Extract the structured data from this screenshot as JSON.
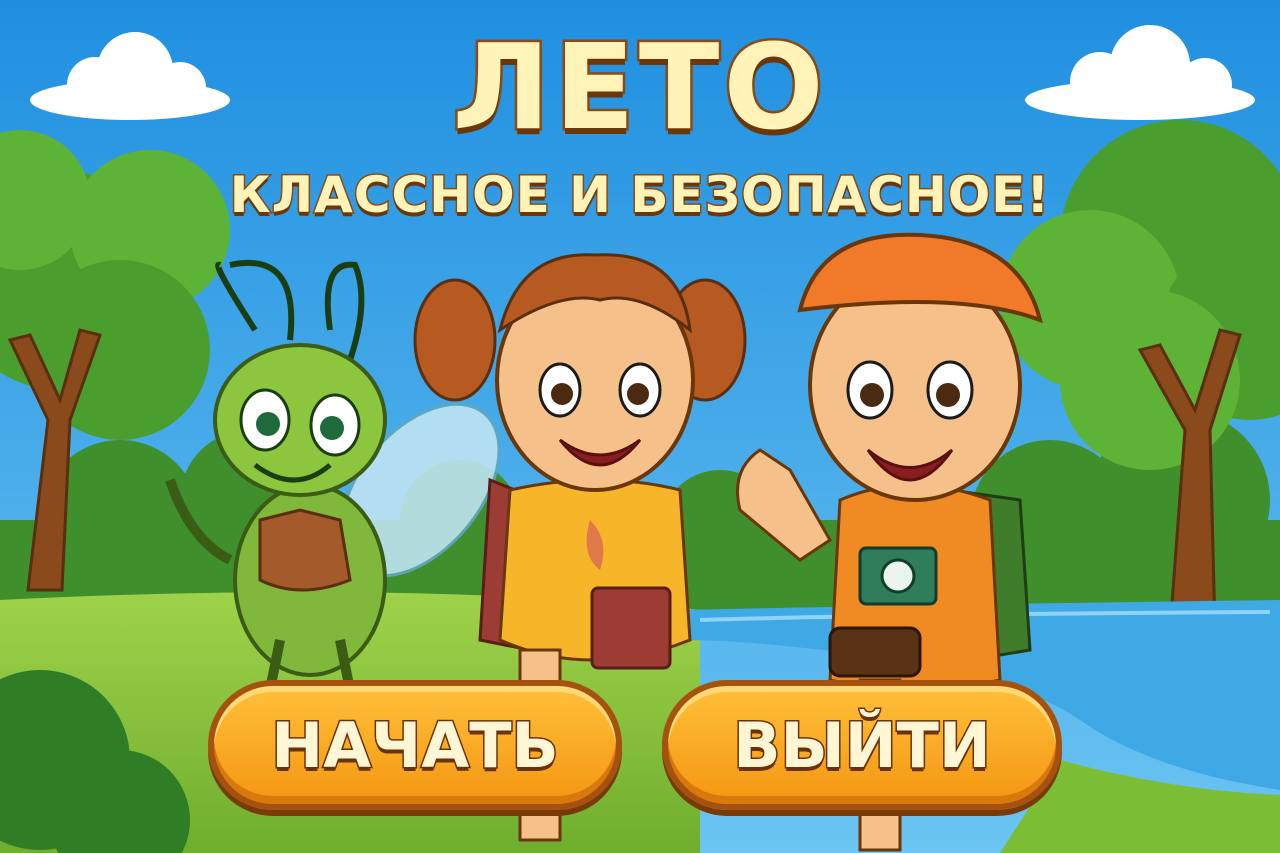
{
  "title": {
    "main": "ЛЕТО",
    "subtitle": "КЛАССНОЕ И БЕЗОПАСНОЕ!"
  },
  "buttons": {
    "start_label": "НАЧАТЬ",
    "exit_label": "ВЫЙТИ"
  },
  "colors": {
    "sky": "#2f9ee6",
    "grass": "#8cc63f",
    "river": "#3fa9e6",
    "button": "#f6a21b",
    "title_text": "#fff3b8",
    "title_outline": "#8a4a12"
  },
  "characters": [
    "grasshopper-mascot",
    "girl-with-backpack",
    "boy-with-camera"
  ]
}
